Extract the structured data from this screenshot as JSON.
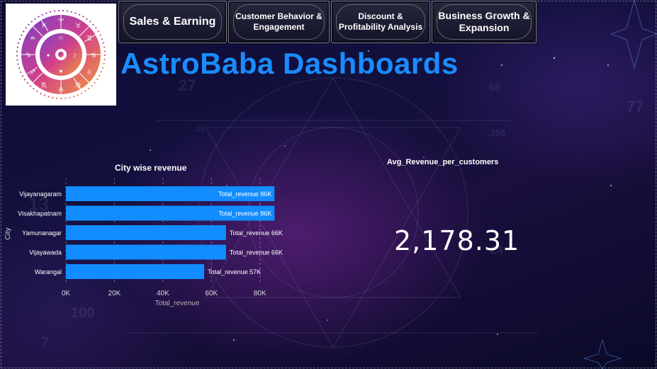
{
  "nav": {
    "buttons": [
      {
        "label": "Sales  & Earning"
      },
      {
        "label": "Customer Behavior & Engagement"
      },
      {
        "label": "Discount & Profitability  Analysis"
      },
      {
        "label": "Business Growth & Expansion"
      }
    ]
  },
  "header": {
    "title": "AstroBaba Dashboards"
  },
  "city_chart": {
    "title": "City wise revenue",
    "xlabel": "Total_revenue",
    "ylabel": "City"
  },
  "kpi": {
    "label": "Avg_Revenue_per_customers",
    "value": "2,178.31"
  },
  "colors": {
    "bar": "#118dff",
    "title": "#1a8cff"
  },
  "chart_data": {
    "type": "bar",
    "orientation": "horizontal",
    "title": "City wise revenue",
    "xlabel": "Total_revenue",
    "ylabel": "City",
    "categories": [
      "Vijayanagaram",
      "Visakhapatnam",
      "Yamunanagar",
      "Vijayawada",
      "Warangal"
    ],
    "values": [
      86000,
      86000,
      66000,
      66000,
      57000
    ],
    "data_labels": [
      "Total_revenue 86K",
      "Total_revenue 86K",
      "Total_revenue 66K",
      "Total_revenue 66K",
      "Total_revenue 57K"
    ],
    "xticks": [
      "0K",
      "20K",
      "40K",
      "60K",
      "80K"
    ],
    "xlim": [
      0,
      90000
    ],
    "grid": true
  }
}
